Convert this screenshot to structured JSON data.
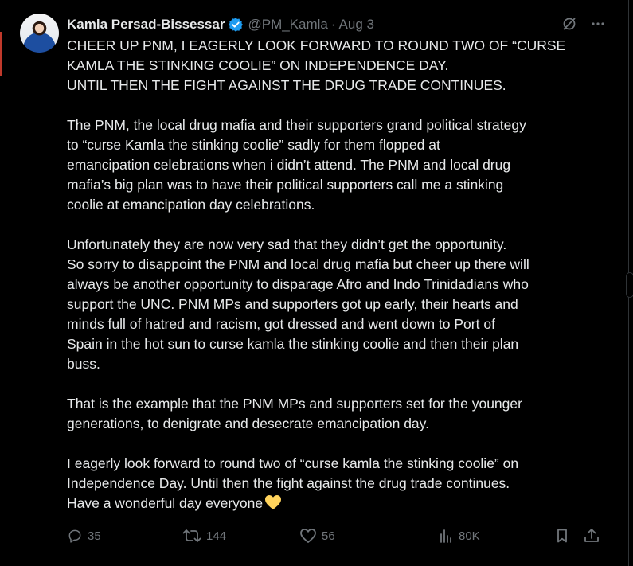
{
  "author": {
    "name": "Kamla Persad-Bissessar",
    "handle": "@PM_Kamla",
    "separator": "·",
    "timestamp": "Aug 3"
  },
  "post": {
    "paragraphs": [
      "CHEER UP PNM, I EAGERLY LOOK FORWARD TO ROUND TWO OF “CURSE\nKAMLA THE STINKING COOLIE” ON INDEPENDENCE DAY.\nUNTIL THEN THE FIGHT AGAINST THE DRUG TRADE CONTINUES.",
      "The PNM, the local drug mafia and their supporters grand political strategy\nto “curse Kamla the stinking coolie” sadly for them flopped at\nemancipation celebrations when i didn’t attend. The PNM and local drug\nmafia’s  big plan was to have their political supporters call me a stinking\ncoolie at emancipation day celebrations.",
      "Unfortunately they are now  very sad that they didn’t get the opportunity.\nSo sorry to disappoint the PNM and local drug mafia but cheer up there will\nalways be another opportunity to disparage Afro and Indo Trinidadians who\nsupport the UNC. PNM MPs and supporters got up early, their hearts and\nminds full of hatred and racism, got  dressed and went down to Port of\nSpain in the hot sun to curse  kamla the stinking coolie and then their plan\nbuss.",
      "That is the example that the PNM MPs and supporters set for the younger\ngenerations, to denigrate and desecrate emancipation day.",
      "I eagerly look forward to round two of “curse kamla the stinking coolie” on\nIndependence Day. Until then the fight against the drug trade continues.\nHave a wonderful day everyone"
    ],
    "emoji_icon": "yellow-heart-icon"
  },
  "metrics": {
    "replies": "35",
    "reposts": "144",
    "likes": "56",
    "views": "80K"
  },
  "colors": {
    "background": "#000000",
    "text": "#e7e9ea",
    "muted": "#71767b",
    "verified": "#1d9bf0",
    "heart": "#ffd35c"
  }
}
